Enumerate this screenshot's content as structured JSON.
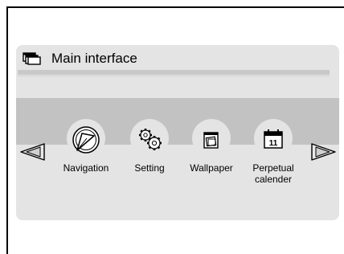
{
  "panel": {
    "title": "Main interface",
    "title_icon": "windows-stack-icon"
  },
  "navigation_arrows": {
    "left_icon": "left-triangle-arrow-icon",
    "right_icon": "right-triangle-arrow-icon"
  },
  "apps": [
    {
      "label": "Navigation",
      "icon": "navigation-compass-icon"
    },
    {
      "label": "Setting",
      "icon": "gears-icon"
    },
    {
      "label": "Wallpaper",
      "icon": "wallpaper-frames-icon"
    },
    {
      "label": "Perpetual calender",
      "icon": "calendar-icon",
      "calendar_number": "11"
    }
  ]
}
